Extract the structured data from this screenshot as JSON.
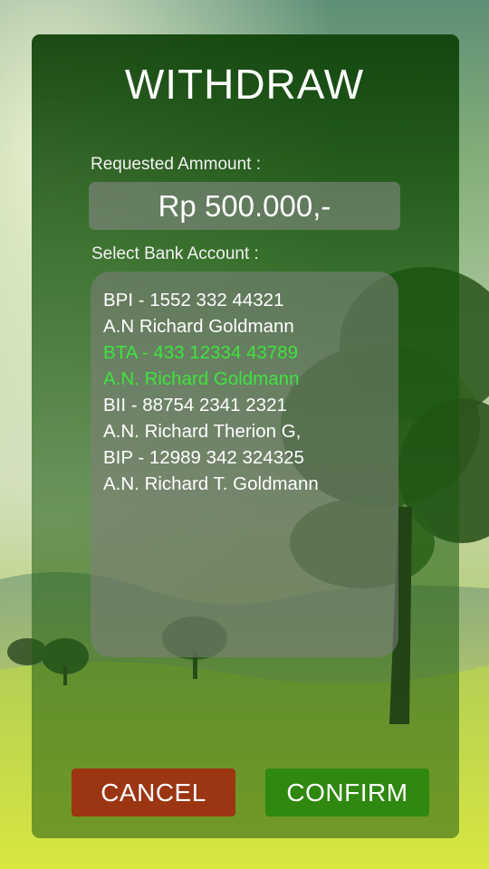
{
  "title": "WITHDRAW",
  "amount": {
    "label": "Requested Ammount :",
    "value": "Rp 500.000,-"
  },
  "bank_accounts": {
    "label": "Select Bank Account :",
    "items": [
      {
        "line1": "BPI - 1552 332 44321",
        "line2": "A.N Richard Goldmann",
        "selected": false
      },
      {
        "line1": "BTA - 433 12334 43789",
        "line2": "A.N. Richard Goldmann",
        "selected": true
      },
      {
        "line1": "BII - 88754 2341 2321",
        "line2": "A.N. Richard Therion G,",
        "selected": false
      },
      {
        "line1": "BIP - 12989 342 324325",
        "line2": "A.N. Richard T. Goldmann",
        "selected": false
      }
    ]
  },
  "buttons": {
    "cancel": "CANCEL",
    "confirm": "CONFIRM"
  },
  "colors": {
    "selected_text": "#3fe33f",
    "cancel_button": "#9c3511",
    "confirm_button": "#2f880f"
  }
}
